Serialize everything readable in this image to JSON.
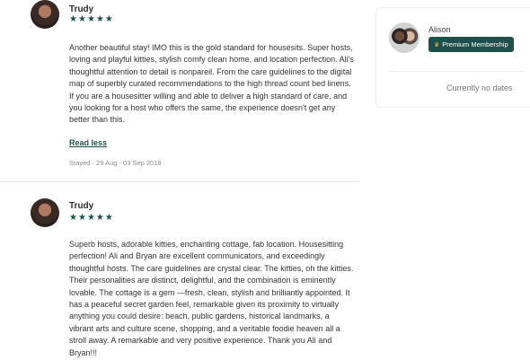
{
  "reviews": [
    {
      "name": "Trudy",
      "rating": 5,
      "text": "Another beautiful stay! IMO this is the gold standard for housesits. Super hosts, loving and playful kitties, stylish comfy clean home, and location perfection. Ali's thoughtful attention to detail is nonpareil. From the care guidelines to the digital map of superbly curated recommendations to the high thread count bed linens. If you are a housesitter willing and able to deliver a high standard of care, and you looking for a host who offers the same, the experience doesn't get any better than this.",
      "toggle_label": "Read less",
      "stayed": "Stayed · 29 Aug - 03 Sep 2018"
    },
    {
      "name": "Trudy",
      "rating": 5,
      "text": "Superb hosts, adorable kitties, enchanting cottage, fab location. Housesitting perfection! Ali and Bryan are excellent communicators, and exceedingly thoughtful hosts. The care guidelines are crystal clear. The kitties, oh the kitties. Their personalities are distinct, delightful, and the combination is eminently lovable. The cottage is a gem —fresh, clean, stylish and brilliantly appointed. It has a peaceful secret garden feel, remarkable given its proximity to virtually anything you could desire: beach, public gardens, historical landmarks, a vibrant arts and culture scene, shopping, and a veritable foodie heaven all a stroll away. A remarkable and very positive experience. Thank you Ali and Bryan!!!"
    }
  ],
  "host_card": {
    "name": "Alison",
    "badge_label": "Premium Membership",
    "badge_icon": "crown-icon",
    "availability": "Currently no dates"
  },
  "colors": {
    "accent": "#1f4f4a",
    "badge_icon": "#e8b23a"
  }
}
